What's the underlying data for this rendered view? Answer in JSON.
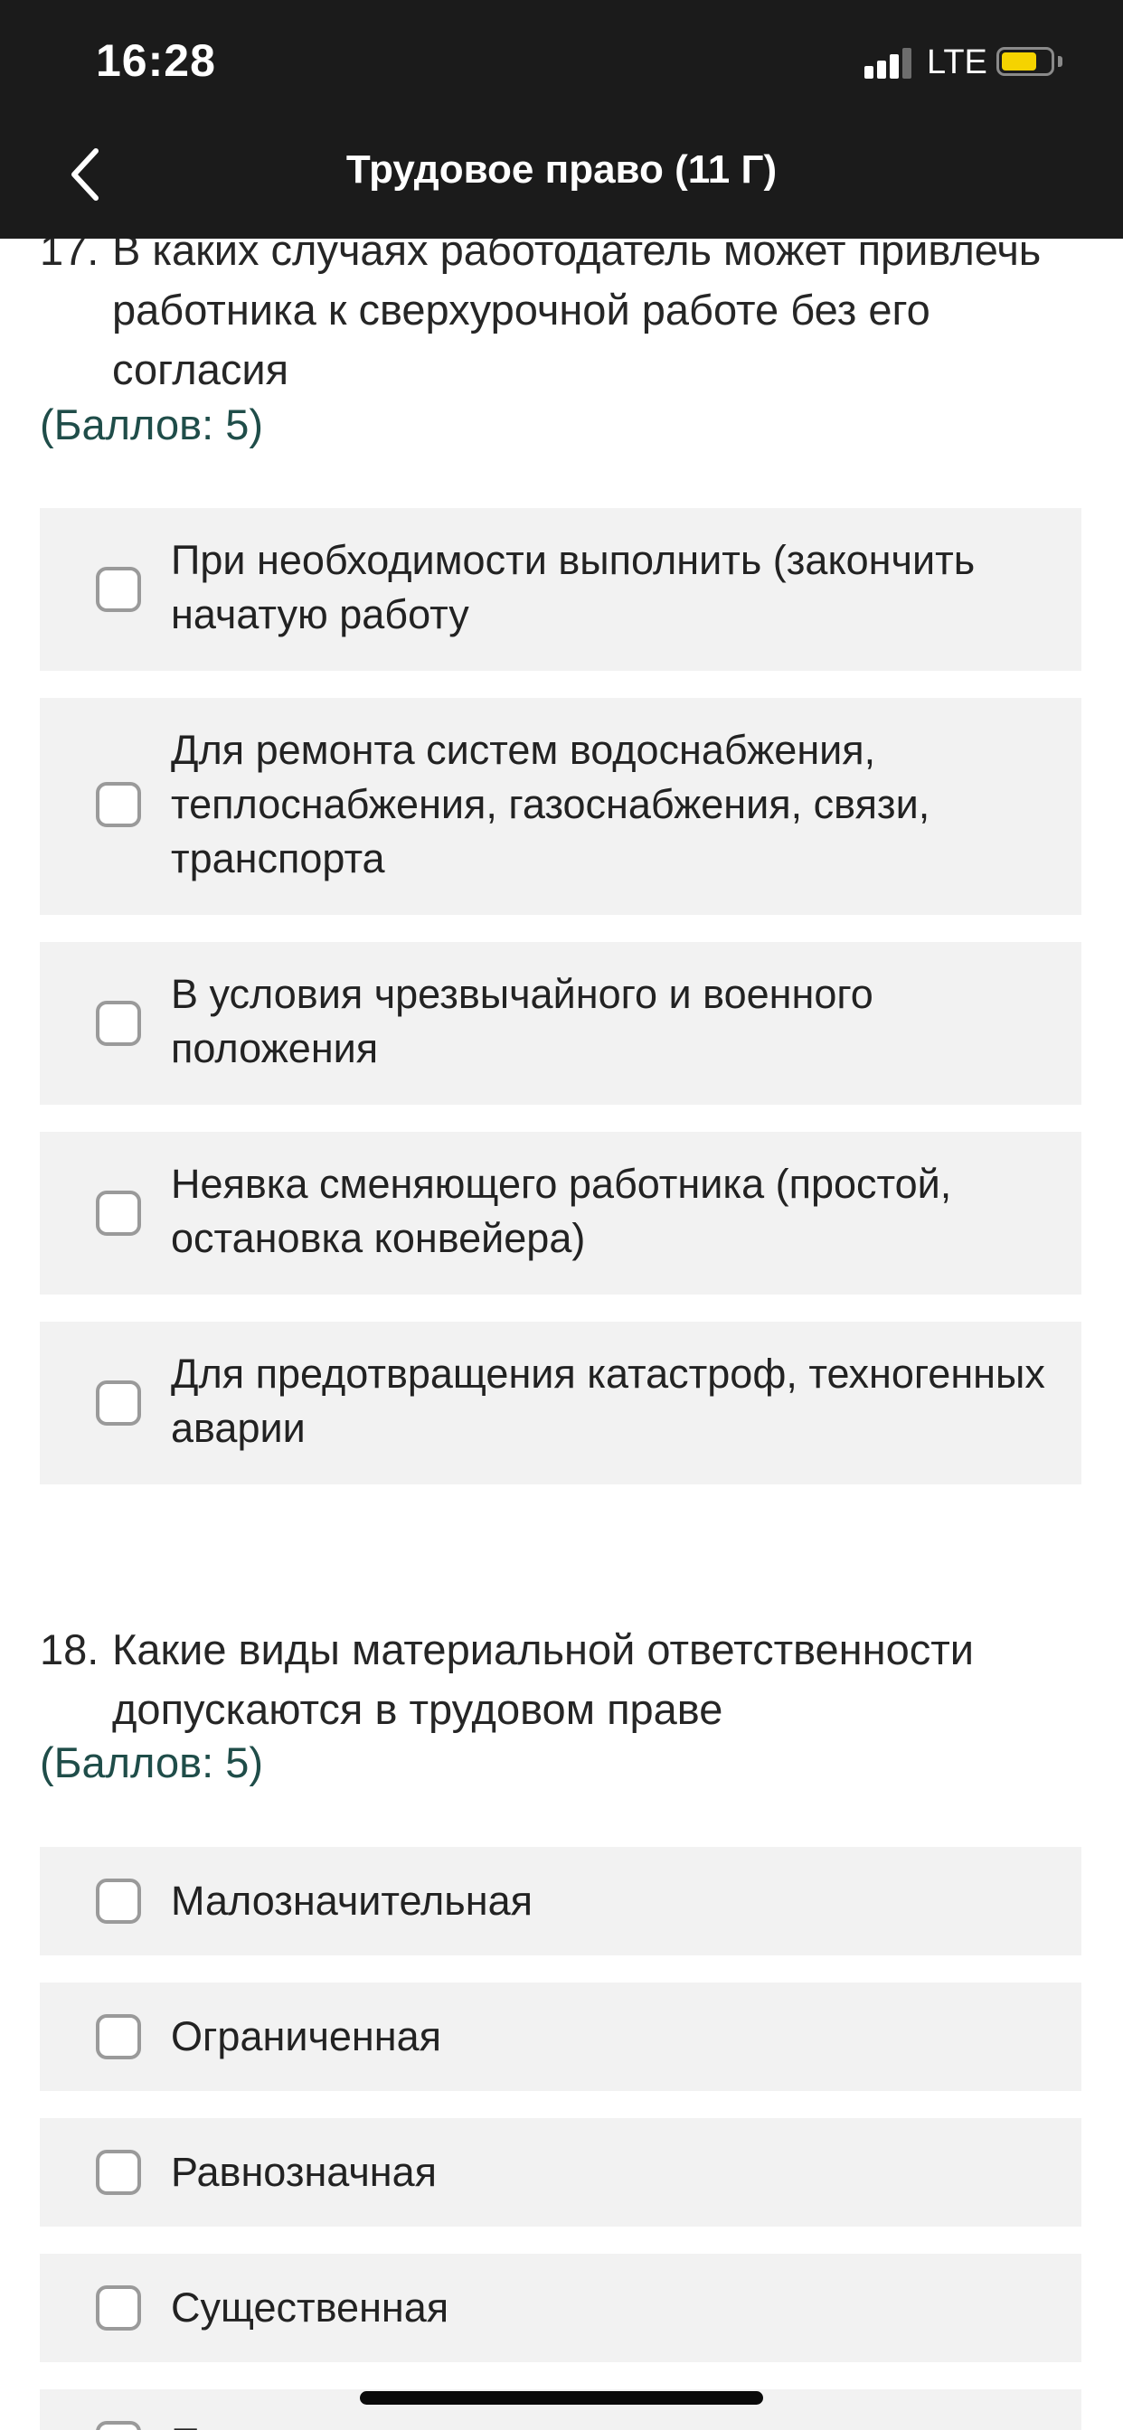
{
  "status_bar": {
    "time": "16:28",
    "network": "LTE",
    "icons": [
      "signal-icon",
      "battery-icon"
    ],
    "battery_color": "#f5d300"
  },
  "nav": {
    "title": "Трудовое право (11  Г)",
    "back_icon": "chevron-left-icon"
  },
  "questions": [
    {
      "number": "17.",
      "text": "В каких случаях работодатель может привлечь работника к сверхурочной работе без его согласия",
      "points": "(Баллов: 5)",
      "options": [
        "При необходимости выполнить (закончить начатую работу",
        "Для ремонта систем водоснабжения, теплоснабжения, газоснабжения, связи, транспорта",
        "В условия чрезвычайного и военного положения",
        "Неявка сменяющего работника (простой, остановка конвейера)",
        "Для предотвращения катастроф, техногенных аварии"
      ]
    },
    {
      "number": "18.",
      "text": "Какие виды материальной ответственности допускаются в трудовом праве",
      "points": "(Баллов: 5)",
      "options": [
        "Малозначительная",
        "Ограниченная",
        "Равнозначная",
        "Существенная",
        "П"
      ]
    }
  ],
  "colors": {
    "header_bg": "#1b1b1b",
    "option_bg": "#f2f2f2",
    "points_color": "#1f4d49",
    "checkbox_border": "#9a9a9a"
  }
}
